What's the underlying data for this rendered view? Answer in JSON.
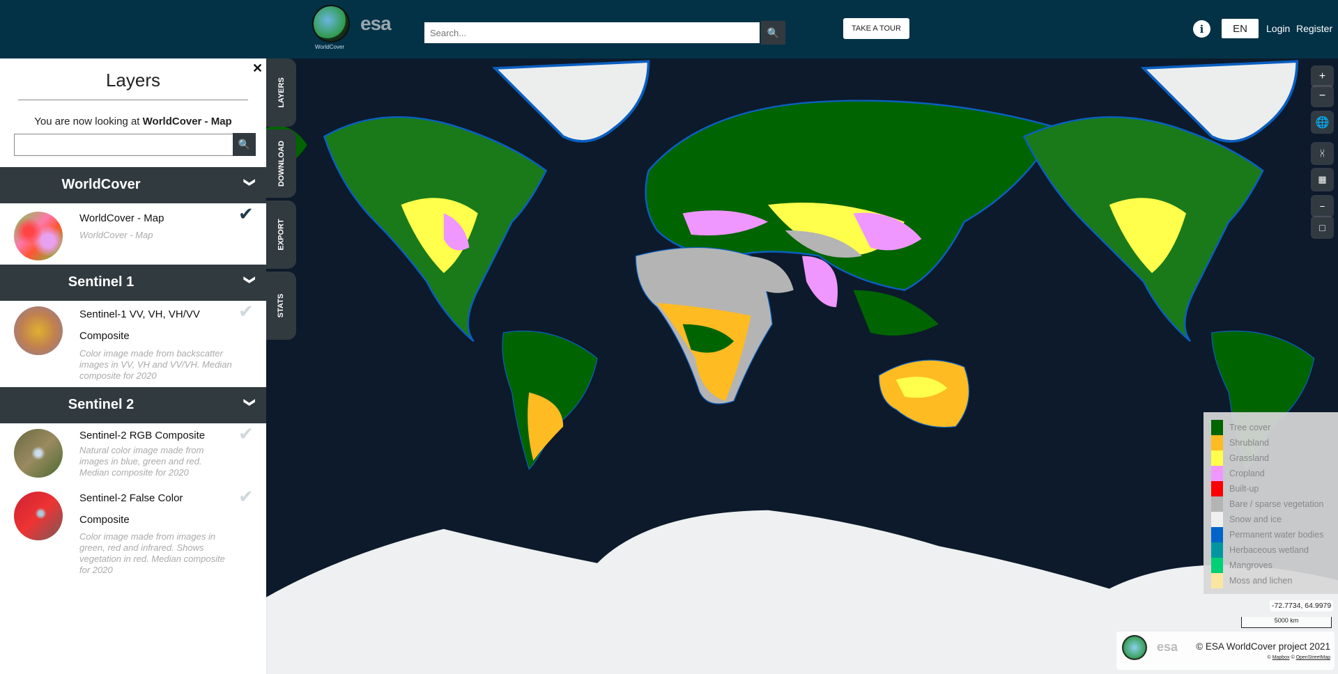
{
  "header": {
    "logo_text": "WorldCover",
    "esa_logo": "esa",
    "search_placeholder": "Search...",
    "tour_label": "TAKE A TOUR",
    "info_icon": "info-icon",
    "lang": "EN",
    "login": "Login",
    "register": "Register"
  },
  "sidebar": {
    "title": "Layers",
    "looking_prefix": "You are now looking at",
    "looking_layer": "WorldCover - Map",
    "search_placeholder": "",
    "groups": [
      {
        "title": "WorldCover",
        "items": [
          {
            "name": "WorldCover - Map",
            "desc": "WorldCover - Map",
            "active": true
          }
        ]
      },
      {
        "title": "Sentinel 1",
        "items": [
          {
            "name": "Sentinel-1 VV, VH, VH/VV",
            "name2": "Composite",
            "desc": "Color image made from backscatter images in VV, VH and VV/VH. Median composite for 2020",
            "active": false
          }
        ]
      },
      {
        "title": "Sentinel 2",
        "items": [
          {
            "name": "Sentinel-2 RGB Composite",
            "desc": "Natural color image made from images in blue, green and red. Median composite for 2020",
            "active": false
          },
          {
            "name": "Sentinel-2 False Color",
            "name2": "Composite",
            "desc": "Color image made from images in green, red and infrared. Shows vegetation in red. Median composite for 2020",
            "active": false
          }
        ]
      }
    ]
  },
  "tabs": [
    "LAYERS",
    "DOWNLOAD",
    "EXPORT",
    "STATS"
  ],
  "map_controls": [
    "zoom-in",
    "zoom-out",
    "globe",
    "share",
    "basemap",
    "measure",
    "draw-area"
  ],
  "legend": [
    {
      "label": "Tree cover",
      "color": "#006400"
    },
    {
      "label": "Shrubland",
      "color": "#ffbb22"
    },
    {
      "label": "Grassland",
      "color": "#ffff4c"
    },
    {
      "label": "Cropland",
      "color": "#f096ff"
    },
    {
      "label": "Built-up",
      "color": "#fa0000"
    },
    {
      "label": "Bare / sparse vegetation",
      "color": "#b4b4b4"
    },
    {
      "label": "Snow and ice",
      "color": "#f0f0f0"
    },
    {
      "label": "Permanent water bodies",
      "color": "#0064c8"
    },
    {
      "label": "Herbaceous wetland",
      "color": "#0096a0"
    },
    {
      "label": "Mangroves",
      "color": "#00cf75"
    },
    {
      "label": "Moss and lichen",
      "color": "#fae6a0"
    }
  ],
  "coords": "-72.7734, 64.9979",
  "scale": "5000 km",
  "attribution": {
    "copyright": "© ESA WorldCover project 2021",
    "c1": "©",
    "mapbox": "Mapbox",
    "c2": "©",
    "osm": "OpenStreetMap"
  }
}
